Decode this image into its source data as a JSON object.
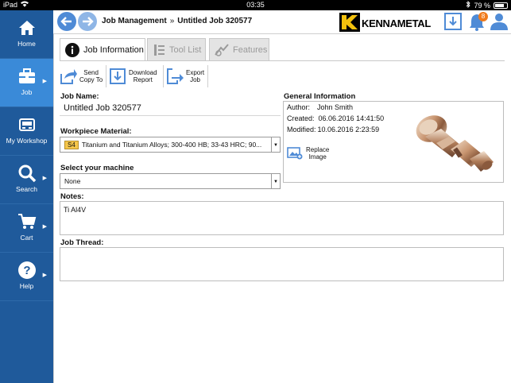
{
  "status_bar": {
    "device": "iPad",
    "time": "03:35",
    "battery": "79 %",
    "battery_level": 0.79
  },
  "sidebar": {
    "items": [
      {
        "label": "Home",
        "icon": "home-icon",
        "active": false
      },
      {
        "label": "Job",
        "icon": "toolbox-icon",
        "active": true
      },
      {
        "label": "My Workshop",
        "icon": "workshop-icon",
        "active": false
      },
      {
        "label": "Search",
        "icon": "search-icon",
        "active": false
      },
      {
        "label": "Cart",
        "icon": "cart-icon",
        "active": false
      },
      {
        "label": "Help",
        "icon": "help-icon",
        "active": false
      }
    ]
  },
  "header": {
    "breadcrumb_root": "Job Management",
    "breadcrumb_sep": "»",
    "breadcrumb_current": "Untitled Job 320577",
    "logo_text": "KENNAMETAL",
    "notification_count": "8"
  },
  "tabs": [
    {
      "label": "Job Information",
      "active": true
    },
    {
      "label": "Tool List",
      "active": false
    },
    {
      "label": "Features",
      "active": false
    }
  ],
  "toolbar": {
    "send": [
      "Send",
      "Copy To"
    ],
    "download": [
      "Download",
      "Report"
    ],
    "export": [
      "Export",
      "Job"
    ]
  },
  "form": {
    "job_name_label": "Job Name:",
    "job_name_value": "Untitled Job 320577",
    "material_label": "Workpiece Material:",
    "material_tag": "S4",
    "material_value": "Titanium and Titanium Alloys; 300-400 HB; 33-43 HRC; 90...",
    "machine_label": "Select your machine",
    "machine_value": "None",
    "notes_label": "Notes:",
    "notes_value": "Ti Al4V",
    "thread_label": "Job Thread:"
  },
  "general_info": {
    "heading": "General Information",
    "author_label": "Author:",
    "author_value": "John Smith",
    "created_label": "Created:",
    "created_value": "06.06.2016 14:41:50",
    "modified_label": "Modified:",
    "modified_value": "10.06.2016 2:23:59",
    "replace_image": [
      "Replace",
      "Image"
    ]
  },
  "colors": {
    "sidebar": "#1f5a9b",
    "sidebar_active": "#3a8ad8",
    "accent": "#4f8bd6",
    "badge": "#f07b1c",
    "logo_yellow": "#f4c20d"
  }
}
